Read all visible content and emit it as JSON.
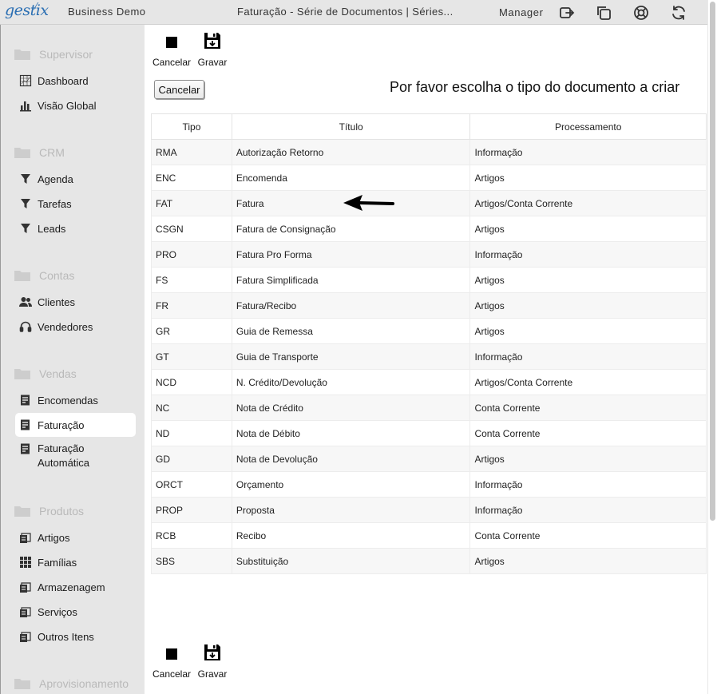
{
  "header": {
    "logo": "gestix",
    "company": "Business Demo",
    "window_title": "Faturação - Série de Documentos | Séries...",
    "user": "Manager",
    "icons": [
      "logout-icon",
      "windows-icon",
      "help-lifebuoy-icon",
      "refresh-icon"
    ]
  },
  "sidebar": {
    "sections": [
      {
        "label": "Supervisor",
        "items": [
          {
            "label": "Dashboard",
            "icon": "dashboard-icon"
          },
          {
            "label": "Visão Global",
            "icon": "bar-chart-icon"
          }
        ]
      },
      {
        "label": "CRM",
        "items": [
          {
            "label": "Agenda",
            "icon": "filter-icon"
          },
          {
            "label": "Tarefas",
            "icon": "filter-icon"
          },
          {
            "label": "Leads",
            "icon": "filter-icon"
          }
        ]
      },
      {
        "label": "Contas",
        "items": [
          {
            "label": "Clientes",
            "icon": "users-icon"
          },
          {
            "label": "Vendedores",
            "icon": "headset-icon"
          }
        ]
      },
      {
        "label": "Vendas",
        "items": [
          {
            "label": "Encomendas",
            "icon": "document-icon"
          },
          {
            "label": "Faturação",
            "icon": "document-icon",
            "active": true
          },
          {
            "label": "Faturação Automática",
            "icon": "document-icon"
          }
        ]
      },
      {
        "label": "Produtos",
        "items": [
          {
            "label": "Artigos",
            "icon": "box-icon"
          },
          {
            "label": "Famílias",
            "icon": "grid-icon"
          },
          {
            "label": "Armazenagem",
            "icon": "box-icon"
          },
          {
            "label": "Serviços",
            "icon": "box-icon"
          },
          {
            "label": "Outros Itens",
            "icon": "box-icon"
          }
        ]
      },
      {
        "label": "Aprovisionamento",
        "items": []
      }
    ]
  },
  "toolbar": {
    "cancel_label": "Cancelar",
    "save_label": "Gravar"
  },
  "main": {
    "cancel_button": "Cancelar",
    "prompt": "Por favor escolha o tipo do documento a criar"
  },
  "table": {
    "headers": [
      "Tipo",
      "Título",
      "Processamento"
    ],
    "rows": [
      [
        "RMA",
        "Autorização Retorno",
        "Informação"
      ],
      [
        "ENC",
        "Encomenda",
        "Artigos"
      ],
      [
        "FAT",
        "Fatura",
        "Artigos/Conta Corrente"
      ],
      [
        "CSGN",
        "Fatura de Consignação",
        "Artigos"
      ],
      [
        "PRO",
        "Fatura Pro Forma",
        "Informação"
      ],
      [
        "FS",
        "Fatura Simplificada",
        "Artigos"
      ],
      [
        "FR",
        "Fatura/Recibo",
        "Artigos"
      ],
      [
        "GR",
        "Guia de Remessa",
        "Artigos"
      ],
      [
        "GT",
        "Guia de Transporte",
        "Informação"
      ],
      [
        "NCD",
        "N. Crédito/Devolução",
        "Artigos/Conta Corrente"
      ],
      [
        "NC",
        "Nota de Crédito",
        "Conta Corrente"
      ],
      [
        "ND",
        "Nota de Débito",
        "Conta Corrente"
      ],
      [
        "GD",
        "Nota de Devolução",
        "Artigos"
      ],
      [
        "ORCT",
        "Orçamento",
        "Informação"
      ],
      [
        "PROP",
        "Proposta",
        "Informação"
      ],
      [
        "RCB",
        "Recibo",
        "Conta Corrente"
      ],
      [
        "SBS",
        "Substituição",
        "Artigos"
      ]
    ]
  },
  "annotation": {
    "icon": "arrow-left-icon",
    "points_to_row": "FAT"
  }
}
